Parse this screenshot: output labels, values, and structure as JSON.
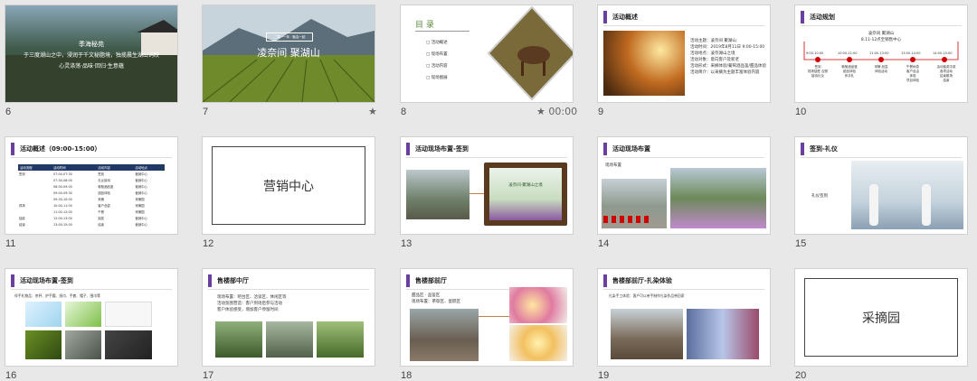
{
  "slides": [
    {
      "num": "6",
      "title": "季海秘苑",
      "line1": "于三度湖山之中，浸润于千文秘脂境，独揽晨生湖山词映",
      "line2": "心灵涤荡·品味·回归·生意蕴"
    },
    {
      "num": "7",
      "title": "凌奈间 聚湖山",
      "subtitle": "二零一一年 · 聚会一起",
      "star": "★"
    },
    {
      "num": "8",
      "toc_title": "目 录",
      "toc_items": [
        "活动概述",
        "现场布置",
        "活动内容",
        "现场图展"
      ],
      "star": "★",
      "time": "00:00"
    },
    {
      "num": "9",
      "header": "活动概述",
      "lines": [
        "活动主题：凌奈间 聚湖山",
        "活动时间：2019年8月11日 9:00-15:00",
        "活动地点：凌奈湖山之境",
        "活动对象：意向客户及新老",
        "活动形式：采摘体验/葡萄酒品鉴/甜品体验",
        "活动简介：以采摘为主题丰富体验内容"
      ]
    },
    {
      "num": "10",
      "header": "活动规划",
      "center_title": "凌奈间 聚湖山",
      "center_sub": "8.11-12点至销售中心",
      "times": [
        "9:00-10:00",
        "10:00-11:00",
        "11:00-13:00",
        "13:00-14:00",
        "14:00-15:00"
      ],
      "items": [
        "签到\n现场抽签 合照\n接待礼仪",
        "葡萄酒品鉴\n甜品体验\n伴手礼",
        "采摘 品尝\n体验活动",
        "午餐休息\n客户自由\n体验\n项目体验",
        "活动抽奖中奖\n各项活动\n结束散场\n结束"
      ]
    },
    {
      "num": "11",
      "header": "活动概述（09:00-15:00）",
      "table_headers": [
        "活动流程",
        "活动时间",
        "活动内容",
        "活动地点"
      ],
      "rows": [
        [
          "签到",
          "07:00-07:30",
          "签到",
          "营销中心"
        ],
        [
          "",
          "07:30-08:00",
          "礼仪接待",
          "营销中心"
        ],
        [
          "",
          "08:00-09:00",
          "葡萄酒品鉴",
          "营销中心"
        ],
        [
          "",
          "09:00-09:30",
          "甜品体验",
          "营销中心"
        ],
        [
          "",
          "09:30-10:00",
          "采摘",
          "采摘园"
        ],
        [
          "现场",
          "10:00-11:00",
          "客户品尝",
          "采摘园"
        ],
        [
          "",
          "11:00-12:00",
          "午餐",
          "采摘园"
        ],
        [
          "抽奖",
          "12:00-13:00",
          "抽奖",
          "营销中心"
        ],
        [
          "结束",
          "13:00-15:00",
          "结束",
          "营销中心"
        ]
      ]
    },
    {
      "num": "12",
      "label": "营销中心"
    },
    {
      "num": "13",
      "header": "活动现场布置-签到",
      "board": "凌奈间·聚湖山之境"
    },
    {
      "num": "14",
      "header": "活动现场布置",
      "caption": "现场布置"
    },
    {
      "num": "15",
      "header": "签到-礼仪",
      "caption": "礼仪签到"
    },
    {
      "num": "16",
      "header": "活动现场布置-签到",
      "caption": "伴手礼物品：茶杯、护手霜、纸巾、手套、帽子、围巾等"
    },
    {
      "num": "17",
      "header": "售楼部中厅",
      "lines": [
        "现场布置：吧台区、洽谈区、休闲区等",
        "活动氛围营造：客户到场后参与活动",
        "客户体验感受，增加客户停留时间"
      ]
    },
    {
      "num": "18",
      "header": "售楼部前厅",
      "lines": [
        "甜品区 · 品鉴区",
        "现场布置：茶歇区、蛋糕区"
      ]
    },
    {
      "num": "19",
      "header": "售楼部前厅-扎染体验",
      "caption": "扎染手工体验：客户可以亲手制作扎染作品带回家"
    },
    {
      "num": "20",
      "label": "采摘园"
    }
  ],
  "colors": {
    "accent": "#6b3fa0",
    "redmark": "#d00000",
    "grass": "#6b8e23"
  }
}
